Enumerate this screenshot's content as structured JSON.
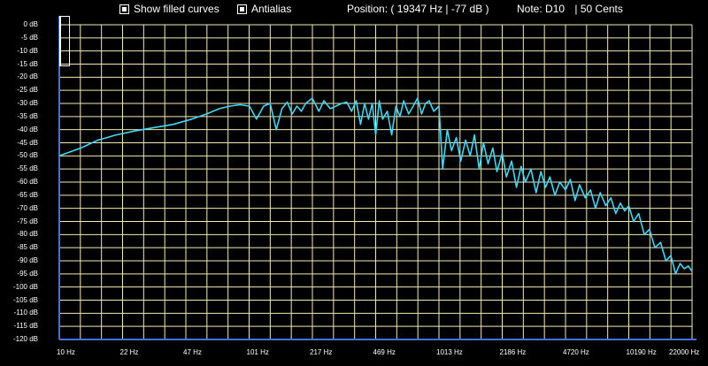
{
  "toolbar": {
    "filled_label": "Show filled curves",
    "antialias_label": "Antialias",
    "position_label": "Position:",
    "position_value": "( 19347 Hz | -77 dB  )",
    "note_label": "Note:",
    "note_value": "D10",
    "cents_value": "| 50 Cents"
  },
  "colors": {
    "curve": "#3fd8f5",
    "grid": "#f2e9b8",
    "axis": "#4a6fd8"
  },
  "chart_data": {
    "type": "line",
    "y_ticks": [
      "0 dB",
      "-5 dB",
      "-10 dB",
      "-15 dB",
      "-20 dB",
      "-25 dB",
      "-30 dB",
      "-35 dB",
      "-40 dB",
      "-45 dB",
      "-50 dB",
      "-55 dB",
      "-60 dB",
      "-65 dB",
      "-70 dB",
      "-75 dB",
      "-80 dB",
      "-85 dB",
      "-90 dB",
      "-95 dB",
      "-100 dB",
      "-105 dB",
      "-110 dB",
      "-115 dB",
      "-120 dB"
    ],
    "x_ticks": [
      "10 Hz",
      "22 Hz",
      "47 Hz",
      "101 Hz",
      "217 Hz",
      "469 Hz",
      "1013 Hz",
      "2186 Hz",
      "4720 Hz",
      "10190 Hz",
      "22000 Hz"
    ],
    "ylim": [
      -120,
      0
    ],
    "xlim": [
      10,
      22000
    ],
    "x_scale": "log",
    "grid": true,
    "series": [
      {
        "x": [
          10,
          13,
          16,
          20,
          25,
          30,
          40,
          50,
          60,
          70,
          80,
          90,
          101,
          110,
          120,
          130,
          140,
          150,
          160,
          170,
          180,
          190,
          200,
          217,
          235,
          250,
          270,
          290,
          310,
          330,
          350,
          370,
          390,
          410,
          430,
          450,
          469,
          490,
          510,
          540,
          570,
          600,
          630,
          660,
          700,
          740,
          780,
          820,
          860,
          900,
          950,
          1013,
          1060,
          1120,
          1180,
          1250,
          1320,
          1400,
          1480,
          1560,
          1650,
          1740,
          1840,
          1950,
          2050,
          2186,
          2300,
          2450,
          2600,
          2750,
          2900,
          3100,
          3300,
          3500,
          3700,
          3900,
          4150,
          4400,
          4720,
          5000,
          5300,
          5600,
          6000,
          6400,
          6800,
          7200,
          7700,
          8200,
          8700,
          9200,
          9700,
          10190,
          10800,
          11500,
          12300,
          13100,
          14000,
          15000,
          16000,
          17000,
          18000,
          19000,
          20000,
          21000,
          22000
        ],
        "y": [
          -50,
          -47,
          -44,
          -42,
          -40.5,
          -39.5,
          -38,
          -36,
          -34,
          -32,
          -31,
          -30.5,
          -31,
          -36,
          -31,
          -30,
          -40,
          -32,
          -29.5,
          -34,
          -31,
          -33,
          -30,
          -28,
          -33,
          -29,
          -32,
          -31,
          -30,
          -29.5,
          -33,
          -29,
          -38,
          -30,
          -36,
          -30,
          -42,
          -29,
          -36,
          -33,
          -42,
          -31,
          -35,
          -29,
          -34,
          -31,
          -28,
          -34,
          -30,
          -29,
          -33,
          -31,
          -55,
          -40,
          -48,
          -43,
          -52,
          -44,
          -50,
          -42,
          -55,
          -45,
          -53,
          -47,
          -56,
          -49,
          -58,
          -52,
          -62,
          -54,
          -60,
          -55,
          -64,
          -56,
          -62,
          -58,
          -65,
          -60,
          -63,
          -59,
          -67,
          -61,
          -66,
          -63,
          -70,
          -64,
          -69,
          -66,
          -72,
          -68,
          -71,
          -69,
          -75,
          -72,
          -80,
          -78,
          -85,
          -83,
          -90,
          -88,
          -95,
          -91,
          -93,
          -92,
          -94
        ]
      }
    ]
  }
}
